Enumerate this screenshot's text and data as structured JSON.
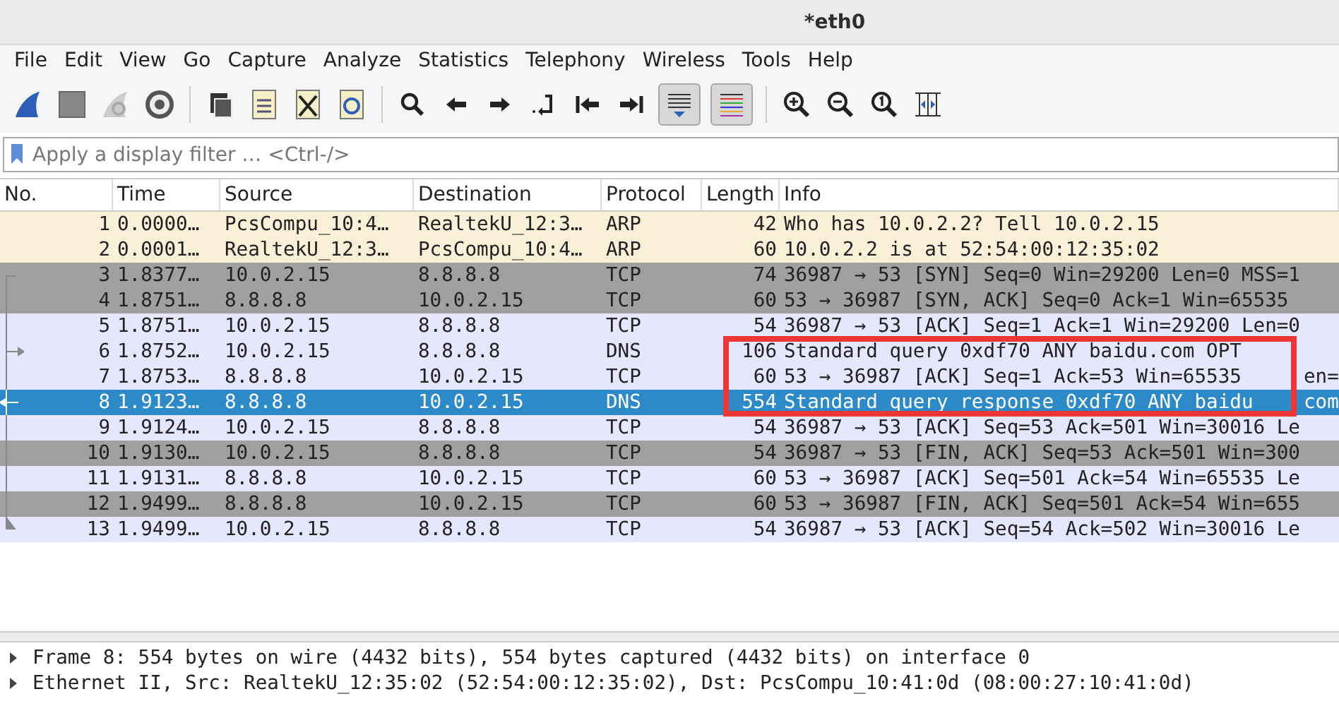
{
  "window": {
    "title": "*eth0"
  },
  "menu": [
    "File",
    "Edit",
    "View",
    "Go",
    "Capture",
    "Analyze",
    "Statistics",
    "Telephony",
    "Wireless",
    "Tools",
    "Help"
  ],
  "toolbar": {
    "autoscroll_on": true,
    "colorize_on": true
  },
  "filter": {
    "placeholder": "Apply a display filter … <Ctrl-/>"
  },
  "table": {
    "columns": [
      "No.",
      "Time",
      "Source",
      "Destination",
      "Protocol",
      "Length",
      "Info"
    ],
    "rows": [
      {
        "no": "1",
        "time": "0.0000…",
        "source": "PcsCompu_10:4…",
        "destination": "RealtekU_12:3…",
        "protocol": "ARP",
        "length": "42",
        "info": "Who has 10.0.2.2? Tell 10.0.2.15",
        "color": "#faf0d7",
        "selected": false,
        "kind": "plain"
      },
      {
        "no": "2",
        "time": "0.0001…",
        "source": "RealtekU_12:3…",
        "destination": "PcsCompu_10:4…",
        "protocol": "ARP",
        "length": "60",
        "info": "10.0.2.2 is at 52:54:00:12:35:02",
        "color": "#faf0d7",
        "selected": false,
        "kind": "plain"
      },
      {
        "no": "3",
        "time": "1.8377…",
        "source": "10.0.2.15",
        "destination": "8.8.8.8",
        "protocol": "TCP",
        "length": "74",
        "info": "36987 → 53 [SYN] Seq=0 Win=29200 Len=0 MSS=1",
        "color": "#a0a0a0",
        "selected": false,
        "kind": "start"
      },
      {
        "no": "4",
        "time": "1.8751…",
        "source": "8.8.8.8",
        "destination": "10.0.2.15",
        "protocol": "TCP",
        "length": "60",
        "info": "53 → 36987 [SYN, ACK] Seq=0 Ack=1 Win=65535",
        "color": "#a0a0a0",
        "selected": false,
        "kind": "through"
      },
      {
        "no": "5",
        "time": "1.8751…",
        "source": "10.0.2.15",
        "destination": "8.8.8.8",
        "protocol": "TCP",
        "length": "54",
        "info": "36987 → 53 [ACK] Seq=1 Ack=1 Win=29200 Len=0",
        "color": "#e7e6ff",
        "selected": false,
        "kind": "through"
      },
      {
        "no": "6",
        "time": "1.8752…",
        "source": "10.0.2.15",
        "destination": "8.8.8.8",
        "protocol": "DNS",
        "length": "106",
        "info": "Standard query 0xdf70 ANY baidu.com OPT",
        "color": "#e7e6ff",
        "selected": false,
        "kind": "request"
      },
      {
        "no": "7",
        "time": "1.8753…",
        "source": "8.8.8.8",
        "destination": "10.0.2.15",
        "protocol": "TCP",
        "length": "60",
        "info": "53 → 36987 [ACK] Seq=1 Ack=53 Win=65535",
        "info_tail": "en=",
        "color": "#e7e6ff",
        "selected": false,
        "kind": "through"
      },
      {
        "no": "8",
        "time": "1.9123…",
        "source": "8.8.8.8",
        "destination": "10.0.2.15",
        "protocol": "DNS",
        "length": "554",
        "info": "Standard query response 0xdf70 ANY baidu",
        "info_tail": "com",
        "selected": true,
        "kind": "response"
      },
      {
        "no": "9",
        "time": "1.9124…",
        "source": "10.0.2.15",
        "destination": "8.8.8.8",
        "protocol": "TCP",
        "length": "54",
        "info": "36987 → 53 [ACK] Seq=53 Ack=501 Win=30016 Le",
        "color": "#e7e6ff",
        "selected": false,
        "kind": "through"
      },
      {
        "no": "10",
        "time": "1.9130…",
        "source": "10.0.2.15",
        "destination": "8.8.8.8",
        "protocol": "TCP",
        "length": "54",
        "info": "36987 → 53 [FIN, ACK] Seq=53 Ack=501 Win=300",
        "color": "#a0a0a0",
        "selected": false,
        "kind": "through"
      },
      {
        "no": "11",
        "time": "1.9131…",
        "source": "8.8.8.8",
        "destination": "10.0.2.15",
        "protocol": "TCP",
        "length": "60",
        "info": "53 → 36987 [ACK] Seq=501 Ack=54 Win=65535 Le",
        "color": "#e7e6ff",
        "selected": false,
        "kind": "through"
      },
      {
        "no": "12",
        "time": "1.9499…",
        "source": "8.8.8.8",
        "destination": "10.0.2.15",
        "protocol": "TCP",
        "length": "60",
        "info": "53 → 36987 [FIN, ACK] Seq=501 Ack=54 Win=655",
        "color": "#a0a0a0",
        "selected": false,
        "kind": "through"
      },
      {
        "no": "13",
        "time": "1.9499…",
        "source": "10.0.2.15",
        "destination": "8.8.8.8",
        "protocol": "TCP",
        "length": "54",
        "info": "36987 → 53 [ACK] Seq=54 Ack=502 Win=30016 Le",
        "color": "#e7e6ff",
        "selected": false,
        "kind": "end"
      }
    ]
  },
  "details": [
    {
      "text": "Frame 8: 554 bytes on wire (4432 bits), 554 bytes captured (4432 bits) on interface 0",
      "expanded": false
    },
    {
      "text": "Ethernet II, Src: RealtekU_12:35:02 (52:54:00:12:35:02), Dst: PcsCompu_10:41:0d (08:00:27:10:41:0d)",
      "expanded": false
    }
  ]
}
